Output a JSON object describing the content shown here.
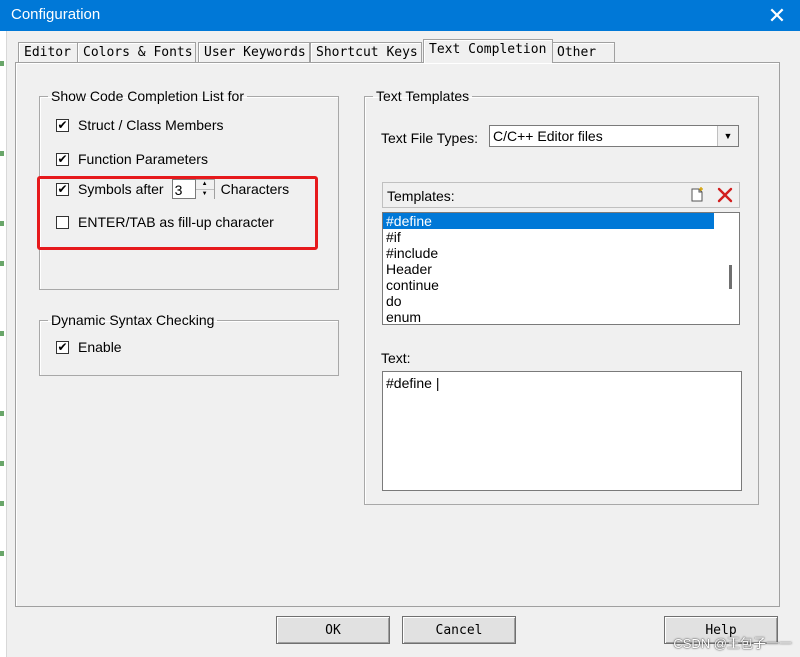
{
  "window": {
    "title": "Configuration",
    "close_glyph": "✕"
  },
  "tabs": [
    {
      "label": "Editor"
    },
    {
      "label": "Colors & Fonts"
    },
    {
      "label": "User Keywords"
    },
    {
      "label": "Shortcut Keys"
    },
    {
      "label": "Text Completion",
      "active": true
    },
    {
      "label": "Other"
    }
  ],
  "completion_group": {
    "legend": "Show Code Completion List for",
    "struct_members": {
      "label": "Struct / Class Members",
      "checked": true
    },
    "function_params": {
      "label": "Function Parameters",
      "checked": true
    },
    "symbols_after": {
      "label": "Symbols after",
      "value": "3",
      "suffix": "Characters",
      "checked": true
    },
    "enter_tab": {
      "label": "ENTER/TAB as fill-up character",
      "checked": false
    }
  },
  "syntax_group": {
    "legend": "Dynamic Syntax Checking",
    "enable": {
      "label": "Enable",
      "checked": true
    }
  },
  "templates_group": {
    "legend": "Text Templates",
    "file_types_label": "Text File Types:",
    "file_types_value": "C/C++ Editor files",
    "templates_label": "Templates:",
    "items": [
      "#define",
      "#if",
      "#include",
      "Header",
      "continue",
      "do",
      "enum"
    ],
    "selected": "#define",
    "text_label": "Text:",
    "text_value": "#define |"
  },
  "buttons": {
    "ok": "OK",
    "cancel": "Cancel",
    "help": "Help"
  },
  "watermark": "CSDN @王包子一一",
  "colors": {
    "titlebar": "#0078d7",
    "highlight": "#e6191c",
    "selection": "#0078d7"
  },
  "icons": {
    "new_template": "new-document-icon",
    "delete_template": "red-x-delete-icon"
  }
}
